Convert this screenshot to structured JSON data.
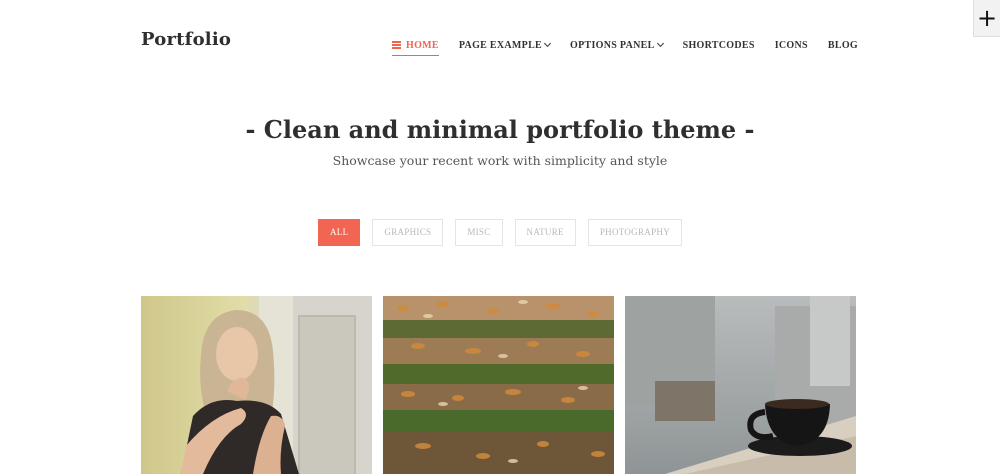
{
  "brand": {
    "logo": "Portfolio"
  },
  "nav": {
    "items": [
      {
        "label": "HOME",
        "active": true,
        "dropdown": false
      },
      {
        "label": "PAGE EXAMPLE",
        "active": false,
        "dropdown": true
      },
      {
        "label": "OPTIONS PANEL",
        "active": false,
        "dropdown": true
      },
      {
        "label": "SHORTCODES",
        "active": false,
        "dropdown": false
      },
      {
        "label": "ICONS",
        "active": false,
        "dropdown": false
      },
      {
        "label": "BLOG",
        "active": false,
        "dropdown": false
      }
    ],
    "home_icon": "menu-icon"
  },
  "corner_button": {
    "icon": "plus-icon"
  },
  "hero": {
    "title": "- Clean and minimal portfolio theme -",
    "subtitle": "Showcase your recent work with simplicity and style"
  },
  "filters": [
    {
      "label": "ALL",
      "active": true
    },
    {
      "label": "GRAPHICS",
      "active": false
    },
    {
      "label": "MISC",
      "active": false
    },
    {
      "label": "NATURE",
      "active": false
    },
    {
      "label": "PHOTOGRAPHY",
      "active": false
    }
  ],
  "colors": {
    "accent": "#f16552",
    "text": "#2f2f2f"
  },
  "portfolio_items": [
    {
      "image": "woman-portrait-photo"
    },
    {
      "image": "autumn-leaves-steps-photo"
    },
    {
      "image": "coffee-cup-photo"
    }
  ]
}
